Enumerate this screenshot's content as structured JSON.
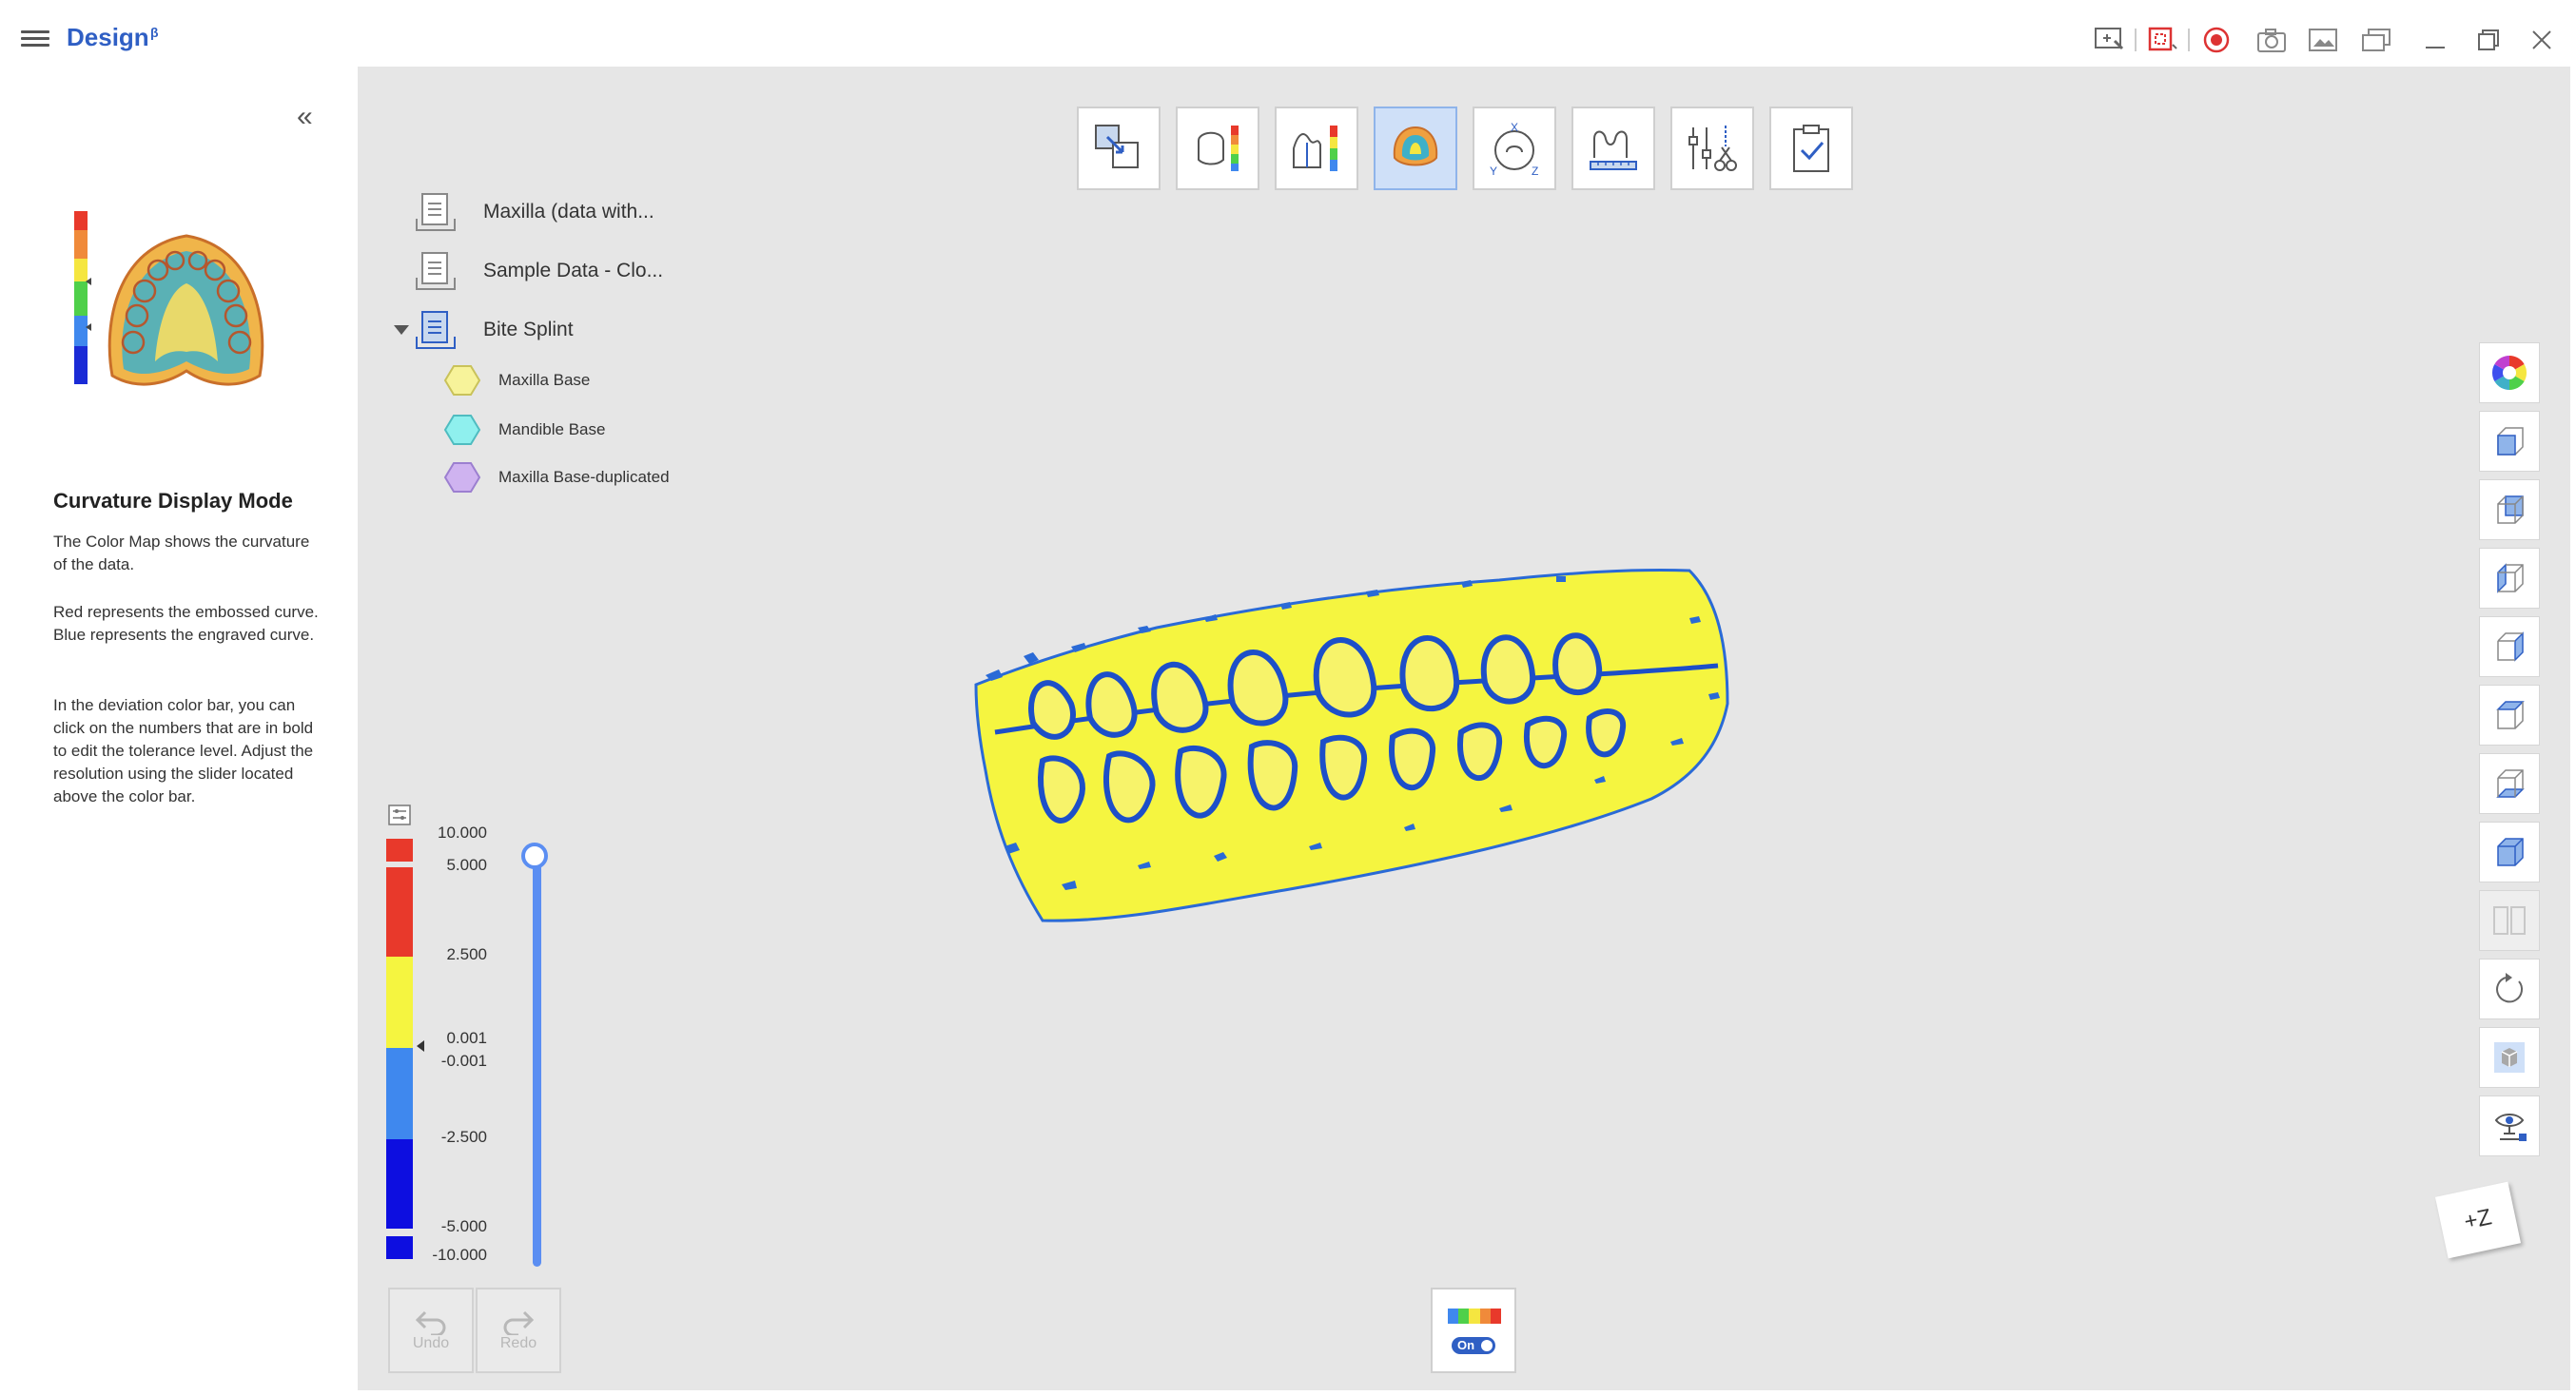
{
  "app": {
    "title": "Design",
    "title_badge": "β"
  },
  "titlebar_icons": [
    "screen-guide-icon",
    "capture-region-icon",
    "record-icon",
    "camera-icon",
    "screenshot-gallery-icon",
    "window-layout-icon",
    "minimize-icon",
    "restore-icon",
    "close-icon"
  ],
  "guide": {
    "title": "Curvature Display Mode",
    "paragraphs": [
      "The Color Map shows the curvature of the data.",
      "Red represents the embossed curve. Blue represents the engraved curve.",
      "In the deviation color bar, you can click on the numbers that are in bold to edit the tolerance level. Adjust the resolution using the slider located above the color bar."
    ]
  },
  "tools": [
    {
      "name": "alignment-tool",
      "icon": "align-icon"
    },
    {
      "name": "deviation-tool",
      "icon": "deviation-map-icon"
    },
    {
      "name": "section-tool",
      "icon": "cross-section-icon"
    },
    {
      "name": "curvature-tool",
      "icon": "curvature-map-icon",
      "active": true
    },
    {
      "name": "axis-tool",
      "icon": "xyz-axis-icon"
    },
    {
      "name": "measure-tool",
      "icon": "measure-profile-icon"
    },
    {
      "name": "trim-tool",
      "icon": "trim-scissors-icon"
    },
    {
      "name": "complete-tool",
      "icon": "checklist-icon"
    }
  ],
  "tree": {
    "items": [
      {
        "label": "Maxilla (data with..."
      },
      {
        "label": "Sample Data - Clo..."
      },
      {
        "label": "Bite Splint",
        "expanded": true
      }
    ],
    "children": [
      {
        "label": "Maxilla Base",
        "color": "#f7f39a"
      },
      {
        "label": "Mandible Base",
        "color": "#8ff0ee"
      },
      {
        "label": "Maxilla Base-duplicated",
        "color": "#cfb3f0"
      }
    ]
  },
  "colorbar": {
    "labels": [
      "10.000",
      "5.000",
      "2.500",
      "0.001",
      "-0.001",
      "-2.500",
      "-5.000",
      "-10.000"
    ],
    "colors": {
      "red": "#e8392b",
      "yellow": "#f5f540",
      "blue_light": "#3f88ee",
      "blue_dark": "#0d0ee0"
    },
    "slider_level": 1.0
  },
  "undo": {
    "label": "Undo"
  },
  "redo": {
    "label": "Redo"
  },
  "colormap_toggle": {
    "state": "On"
  },
  "right_toolbar": [
    "color-wheel-icon",
    "view-front-cube-icon",
    "view-back-cube-icon",
    "view-left-cube-icon",
    "view-right-cube-icon",
    "view-top-cube-icon",
    "view-bottom-cube-icon",
    "view-iso-cube-icon",
    "split-view-icon",
    "rotate-reset-icon",
    "transparency-cube-icon",
    "visibility-settings-icon"
  ],
  "view_cube": {
    "label": "+Z"
  }
}
